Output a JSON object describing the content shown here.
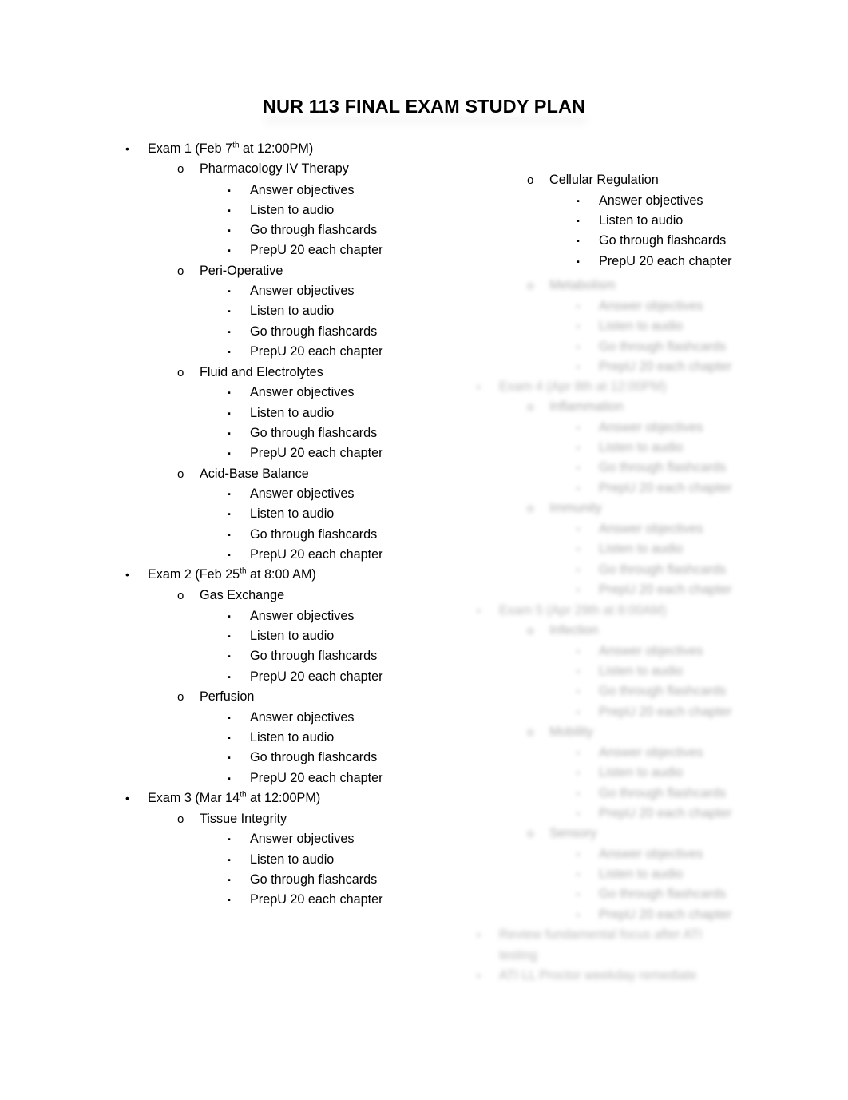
{
  "document": {
    "title": "NUR 113 FINAL EXAM STUDY PLAN",
    "markers": {
      "level1": "•",
      "level2": "o",
      "level3": "▪"
    },
    "tasks": {
      "answer_objectives": "Answer objectives",
      "listen_to_audio": "Listen to audio",
      "go_through_flashcards": "Go through flashcards",
      "prepu": "PrepU 20 each chapter"
    }
  },
  "left_column": {
    "exams": [
      {
        "heading_pre": "Exam 1 (Feb 7",
        "heading_sup": "th",
        "heading_post": " at 12:00PM)",
        "topics": [
          {
            "name": "Pharmacology IV Therapy",
            "tasks": [
              "Answer objectives",
              "Listen to audio",
              "Go through flashcards",
              "PrepU 20 each chapter"
            ]
          },
          {
            "name": "Peri-Operative",
            "tasks": [
              "Answer objectives",
              "Listen to audio",
              "Go through flashcards",
              "PrepU 20 each chapter"
            ]
          },
          {
            "name": "Fluid and Electrolytes",
            "tasks": [
              "Answer objectives",
              "Listen to audio",
              "Go through flashcards",
              "PrepU 20 each chapter"
            ]
          },
          {
            "name": "Acid-Base Balance",
            "tasks": [
              "Answer objectives",
              "Listen to audio",
              "Go through flashcards",
              "PrepU 20 each chapter"
            ]
          }
        ]
      },
      {
        "heading_pre": "Exam 2 (Feb 25",
        "heading_sup": "th",
        "heading_post": " at 8:00 AM)",
        "topics": [
          {
            "name": "Gas Exchange",
            "tasks": [
              "Answer objectives",
              "Listen to audio",
              "Go through flashcards",
              "PrepU 20 each chapter"
            ]
          },
          {
            "name": "Perfusion",
            "tasks": [
              "Answer objectives",
              "Listen to audio",
              "Go through flashcards",
              "PrepU 20 each chapter"
            ]
          }
        ]
      },
      {
        "heading_pre": "Exam 3 (Mar 14",
        "heading_sup": "th",
        "heading_post": " at 12:00PM)",
        "topics": [
          {
            "name": "Tissue Integrity",
            "tasks": [
              "Answer objectives",
              "Listen to audio",
              "Go through flashcards",
              "PrepU 20 each chapter"
            ]
          }
        ]
      }
    ]
  },
  "right_column": {
    "legible": {
      "topic": "Cellular Regulation",
      "tasks": [
        "Answer objectives",
        "Listen to audio",
        "Go through flashcards",
        "PrepU 20 each chapter"
      ]
    },
    "obscured_note": "Remaining right-column content is blurred and illegible in the source image.",
    "obscured_rows": [
      {
        "level": 2,
        "text": "Metabolism"
      },
      {
        "level": 3,
        "text": "Answer objectives"
      },
      {
        "level": 3,
        "text": "Listen to audio"
      },
      {
        "level": 3,
        "text": "Go through flashcards"
      },
      {
        "level": 3,
        "text": "PrepU 20 each chapter"
      },
      {
        "level": 1,
        "text": "Exam 4 (Apr 8th at 12:00PM)"
      },
      {
        "level": 2,
        "text": "Inflammation"
      },
      {
        "level": 3,
        "text": "Answer objectives"
      },
      {
        "level": 3,
        "text": "Listen to audio"
      },
      {
        "level": 3,
        "text": "Go through flashcards"
      },
      {
        "level": 3,
        "text": "PrepU 20 each chapter"
      },
      {
        "level": 2,
        "text": "Immunity"
      },
      {
        "level": 3,
        "text": "Answer objectives"
      },
      {
        "level": 3,
        "text": "Listen to audio"
      },
      {
        "level": 3,
        "text": "Go through flashcards"
      },
      {
        "level": 3,
        "text": "PrepU 20 each chapter"
      },
      {
        "level": 1,
        "text": "Exam 5 (Apr 29th at 8:00AM)"
      },
      {
        "level": 2,
        "text": "Infection"
      },
      {
        "level": 3,
        "text": "Answer objectives"
      },
      {
        "level": 3,
        "text": "Listen to audio"
      },
      {
        "level": 3,
        "text": "Go through flashcards"
      },
      {
        "level": 3,
        "text": "PrepU 20 each chapter"
      },
      {
        "level": 2,
        "text": "Mobility"
      },
      {
        "level": 3,
        "text": "Answer objectives"
      },
      {
        "level": 3,
        "text": "Listen to audio"
      },
      {
        "level": 3,
        "text": "Go through flashcards"
      },
      {
        "level": 3,
        "text": "PrepU 20 each chapter"
      },
      {
        "level": 2,
        "text": "Sensory"
      },
      {
        "level": 3,
        "text": "Answer objectives"
      },
      {
        "level": 3,
        "text": "Listen to audio"
      },
      {
        "level": 3,
        "text": "Go through flashcards"
      },
      {
        "level": 3,
        "text": "PrepU 20 each chapter"
      },
      {
        "level": 1,
        "text": "Review fundamental focus after ATI"
      },
      {
        "level": 1,
        "text": "testing"
      },
      {
        "level": 1,
        "text": "ATI LL Proctor weekday remediate"
      }
    ]
  }
}
